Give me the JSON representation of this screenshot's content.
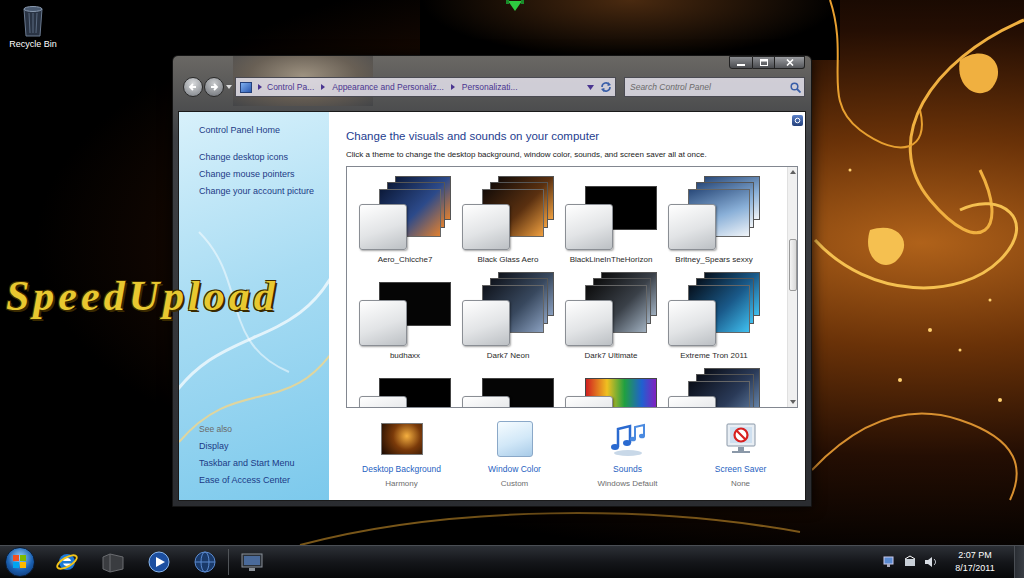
{
  "desktop": {
    "icons": [
      {
        "label": "Recycle Bin"
      }
    ],
    "watermark": "SpeedUpload"
  },
  "window": {
    "breadcrumb": [
      "Control Pa...",
      "Appearance and Personaliz...",
      "Personalizati..."
    ],
    "search": {
      "placeholder": "Search Control Panel"
    },
    "sidebar": {
      "links": [
        "Control Panel Home",
        "Change desktop icons",
        "Change mouse pointers",
        "Change your account picture"
      ],
      "see_also": {
        "title": "See also",
        "links": [
          "Display",
          "Taskbar and Start Menu",
          "Ease of Access Center"
        ]
      }
    },
    "heading": "Change the visuals and sounds on your computer",
    "subtitle": "Click a theme to change the desktop background, window color, sounds, and screen saver all at once.",
    "themes": [
      {
        "name": "Aero_Chicche7",
        "selected": false
      },
      {
        "name": "Black Glass Aero",
        "selected": false
      },
      {
        "name": "BlackLineInTheHorizon",
        "selected": false
      },
      {
        "name": "Britney_Spears sexxy",
        "selected": false
      },
      {
        "name": "budhaxx",
        "selected": false
      },
      {
        "name": "Dark7 Neon",
        "selected": false
      },
      {
        "name": "Dark7 Ultimate",
        "selected": false
      },
      {
        "name": "Extreme Tron 2011",
        "selected": false
      }
    ],
    "settings": [
      {
        "kind": "background",
        "label": "Desktop Background",
        "value": "Harmony"
      },
      {
        "kind": "color",
        "label": "Window Color",
        "value": "Custom"
      },
      {
        "kind": "sounds",
        "label": "Sounds",
        "value": "Windows Default"
      },
      {
        "kind": "screensaver",
        "label": "Screen Saver",
        "value": "None"
      }
    ]
  },
  "taskbar": {
    "clock": {
      "time": "2:07 PM",
      "date": "8/17/2011"
    }
  }
}
